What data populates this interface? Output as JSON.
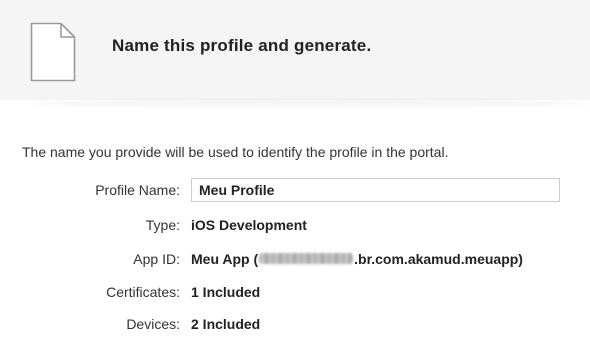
{
  "header": {
    "title": "Name this profile and generate.",
    "icon": "document-icon"
  },
  "intro_text": "The name you provide will be used to identify the profile in the portal.",
  "form": {
    "profile_name": {
      "label": "Profile Name:",
      "value": "Meu Profile"
    },
    "type": {
      "label": "Type:",
      "value": "iOS Development"
    },
    "app_id": {
      "label": "App ID:",
      "value_prefix": "Meu App (",
      "value_suffix": ".br.com.akamud.meuapp)"
    },
    "certificates": {
      "label": "Certificates:",
      "value": "1 Included"
    },
    "devices": {
      "label": "Devices:",
      "value": "2 Included"
    }
  },
  "colors": {
    "header_background": "#f5f5f5",
    "text": "#333333",
    "input_border": "#cccccc"
  }
}
